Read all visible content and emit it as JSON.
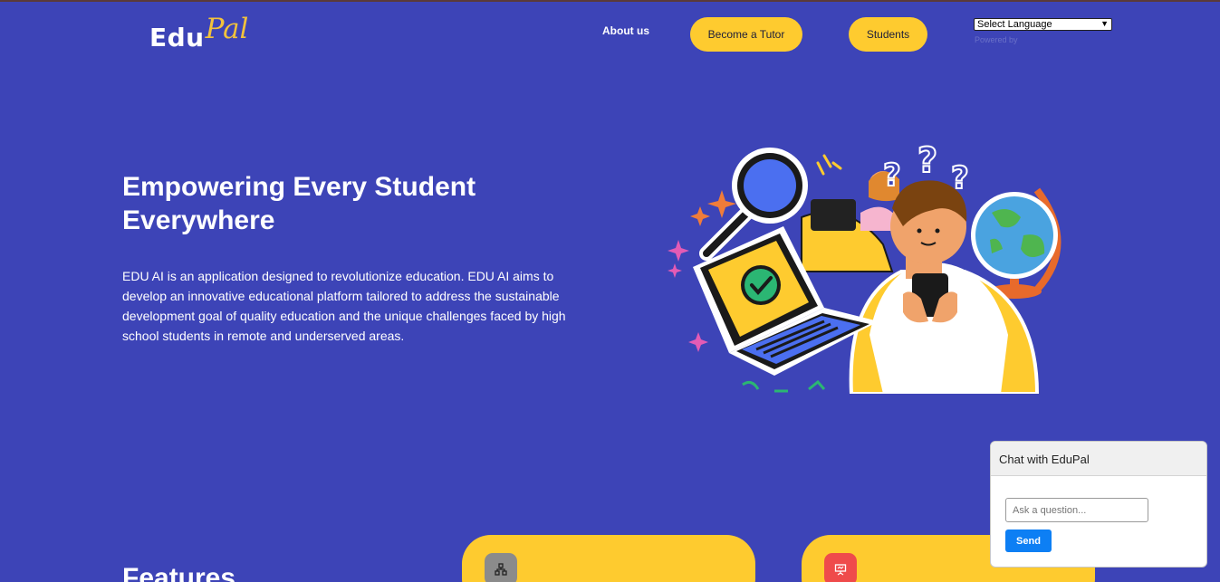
{
  "logo": {
    "part1": "Edu",
    "part2": "Pal"
  },
  "nav": {
    "about": "About us",
    "become_tutor": "Become a Tutor",
    "students": "Students",
    "language_select": "Select Language",
    "powered_by": "Powered by"
  },
  "hero": {
    "title": "Empowering Every Student Everywhere",
    "description": "EDU AI is an application designed to revolutionize education. EDU AI aims to develop an innovative educational platform tailored to address the sustainable development goal of quality education and the unique challenges faced by high school students in remote and underserved areas."
  },
  "features": {
    "title": "Features",
    "cards": [
      {
        "icon": "network-icon"
      },
      {
        "icon": "presentation-icon"
      }
    ]
  },
  "chat": {
    "title": "Chat with EduPal",
    "placeholder": "Ask a question...",
    "send": "Send"
  },
  "colors": {
    "background": "#3d44b7",
    "accent": "#fecb2f",
    "send_button": "#0d7ff4"
  }
}
